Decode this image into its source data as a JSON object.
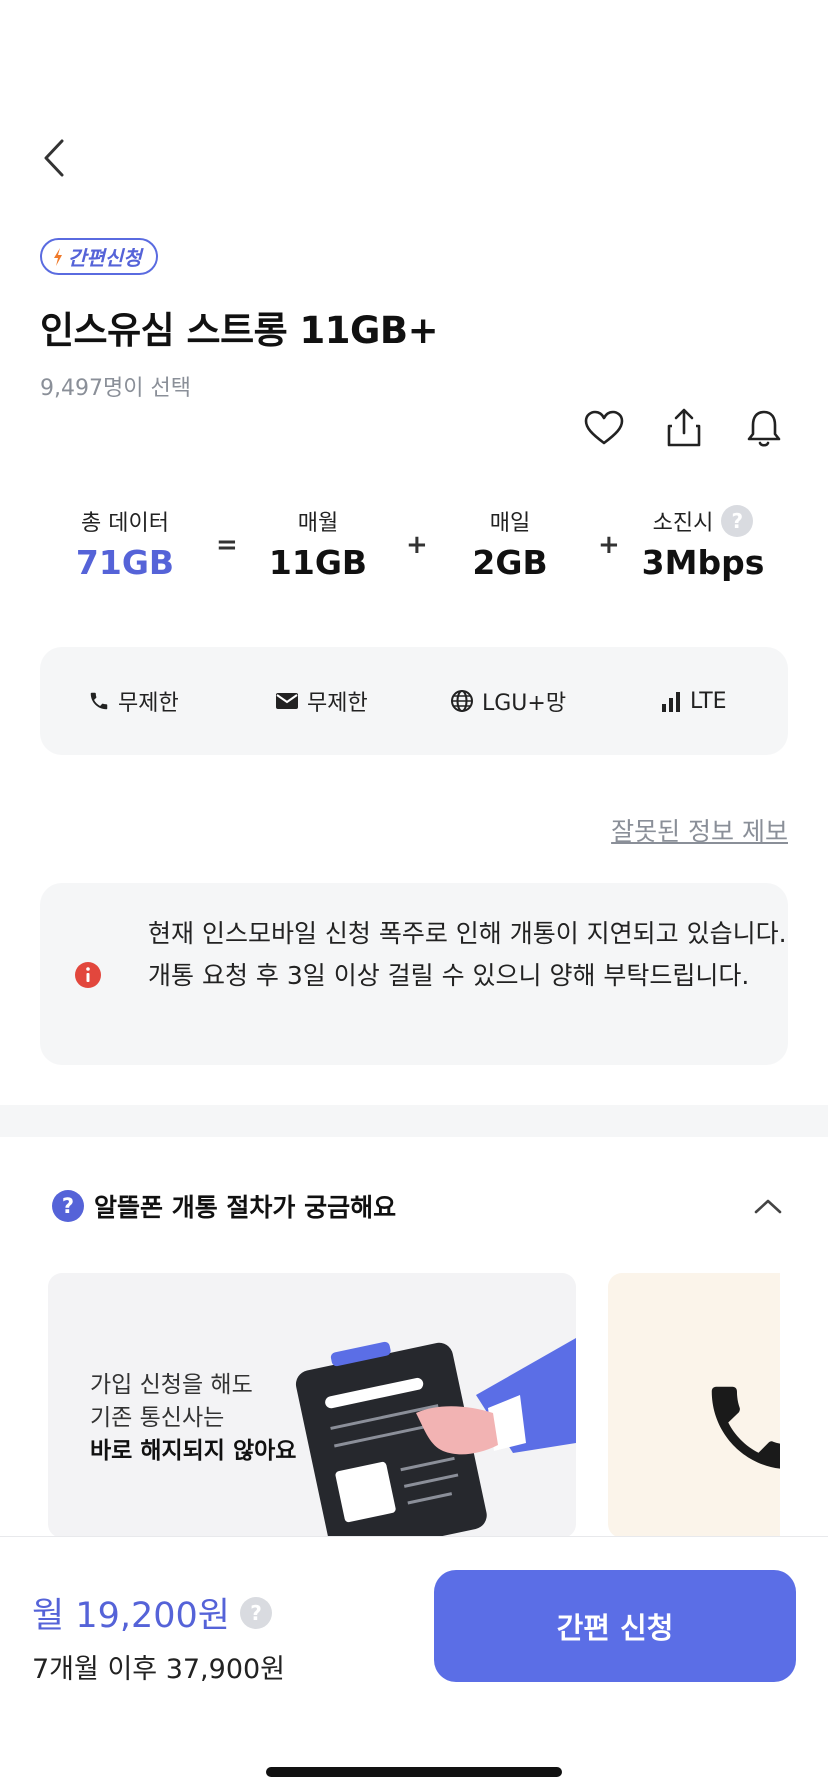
{
  "nav": {
    "back_icon": "chevron-left-icon"
  },
  "badge": {
    "label": "간편신청",
    "icon": "lightning-icon",
    "color": "#5563d8"
  },
  "plan": {
    "title": "인스유심 스트롱 11GB+",
    "selected_count": "9,497명이 선택"
  },
  "actions": [
    {
      "icon": "heart-icon"
    },
    {
      "icon": "share-icon"
    },
    {
      "icon": "bell-icon"
    }
  ],
  "data_breakdown": {
    "total": {
      "label": "총 데이터",
      "value": "71GB"
    },
    "op1": "=",
    "monthly": {
      "label": "매월",
      "value": "11GB"
    },
    "op2": "+",
    "daily": {
      "label": "매일",
      "value": "2GB"
    },
    "op3": "+",
    "exhausted": {
      "label": "소진시",
      "value": "3Mbps",
      "help": "?"
    }
  },
  "specs": [
    {
      "icon": "phone-icon",
      "label": "무제한"
    },
    {
      "icon": "mail-icon",
      "label": "무제한"
    },
    {
      "icon": "globe-icon",
      "label": "LGU+망"
    },
    {
      "icon": "signal-icon",
      "label": "LTE"
    }
  ],
  "report_link": "잘못된 정보 제보",
  "notice": {
    "text": "현재 인스모바일 신청 폭주로 인해 개통이 지연되고 있습니다. 개통 요청 후 3일 이상 걸릴 수 있으니 양해 부탁드립니다."
  },
  "faq": {
    "title": "알뜰폰 개통 절차가 궁금해요",
    "icon": "?",
    "card1": {
      "line1": "가입 신청을 해도",
      "line2": "기존 통신사는",
      "line3": "바로 해지되지 않아요"
    }
  },
  "bottom": {
    "price": "월 19,200원",
    "price_help": "?",
    "after_price": "7개월 이후 37,900원",
    "apply_label": "간편 신청"
  },
  "colors": {
    "accent": "#5563d8",
    "button": "#5b6ee6",
    "notice_icon": "#e2473d"
  }
}
